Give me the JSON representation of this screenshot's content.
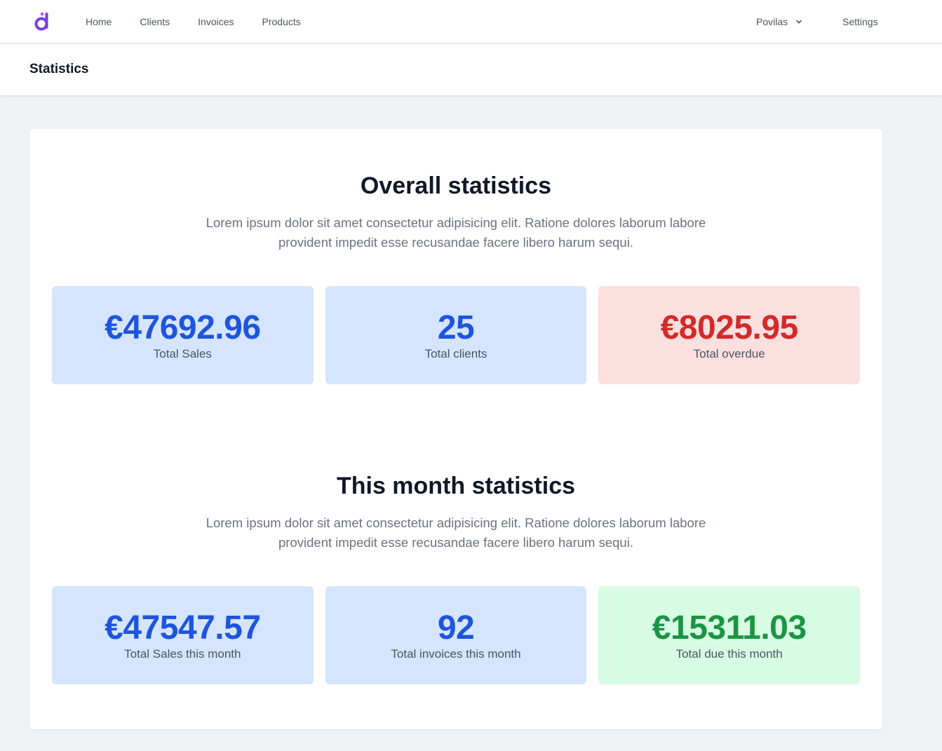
{
  "nav": {
    "links": [
      "Home",
      "Clients",
      "Invoices",
      "Products"
    ],
    "user_name": "Povilas",
    "settings_label": "Settings"
  },
  "header": {
    "title": "Statistics"
  },
  "overall": {
    "title": "Overall statistics",
    "description": "Lorem ipsum dolor sit amet consectetur adipisicing elit. Ratione dolores laborum labore provident impedit esse recusandae facere libero harum sequi.",
    "stats": [
      {
        "value": "€47692.96",
        "label": "Total Sales"
      },
      {
        "value": "25",
        "label": "Total clients"
      },
      {
        "value": "€8025.95",
        "label": "Total overdue"
      }
    ]
  },
  "month": {
    "title": "This month statistics",
    "description": "Lorem ipsum dolor sit amet consectetur adipisicing elit. Ratione dolores laborum labore provident impedit esse recusandae facere libero harum sequi.",
    "stats": [
      {
        "value": "€47547.57",
        "label": "Total Sales this month"
      },
      {
        "value": "92",
        "label": "Total invoices this month"
      },
      {
        "value": "€15311.03",
        "label": "Total due this month"
      }
    ]
  },
  "colors": {
    "blue_bg": "#d5e5fd",
    "blue_text": "#1e55dc",
    "red_bg": "#fcdfdf",
    "red_text": "#d22b2b",
    "green_bg": "#d8fbe4",
    "green_text": "#1c9444",
    "brand": "#7c3aed"
  },
  "icons": {
    "logo": "app-logo-icon",
    "dropdown": "chevron-down-icon"
  }
}
